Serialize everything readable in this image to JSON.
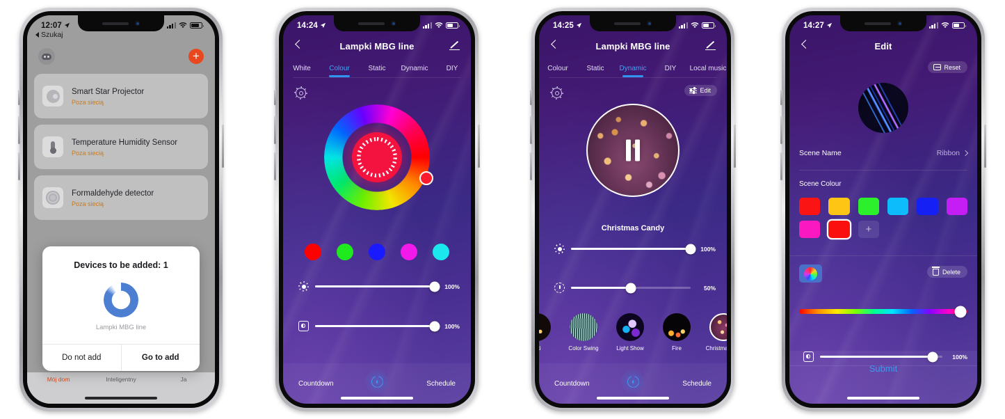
{
  "phones": [
    {
      "id": "device-list",
      "status": {
        "time": "12:07",
        "location_icon": "location-arrow-icon",
        "signal": "signal-bars-icon",
        "wifi": "wifi-icon",
        "battery": "battery-icon"
      },
      "back_link": "Szukaj",
      "toolbar": {
        "scan_icon": "scan-device-icon",
        "add_icon": "plus-icon"
      },
      "devices": [
        {
          "name": "Smart Star Projector",
          "status": "Poza siecią",
          "icon": "projector-icon"
        },
        {
          "name": "Temperature Humidity Sensor",
          "status": "Poza siecią",
          "icon": "thermometer-icon"
        },
        {
          "name": "Formaldehyde detector",
          "status": "Poza siecią",
          "icon": "detector-icon"
        }
      ],
      "dialog": {
        "title": "Devices to be added: 1",
        "device_name": "Lampki MBG line",
        "spinner_icon": "loading-spinner-icon",
        "cancel_label": "Do not add",
        "confirm_label": "Go to add"
      },
      "tabbar": [
        {
          "label": "Mój dom",
          "active": true
        },
        {
          "label": "Inteligentny",
          "active": false
        },
        {
          "label": "Ja",
          "active": false
        }
      ]
    },
    {
      "id": "colour-tab",
      "status": {
        "time": "14:24"
      },
      "nav": {
        "title": "Lampki MBG line",
        "back_icon": "chevron-left-icon",
        "edit_icon": "pencil-icon"
      },
      "tabs": [
        {
          "label": "White",
          "active": false
        },
        {
          "label": "Colour",
          "active": true
        },
        {
          "label": "Static",
          "active": false
        },
        {
          "label": "Dynamic",
          "active": false
        },
        {
          "label": "DIY",
          "active": false
        }
      ],
      "settings_icon": "gear-icon",
      "colour_wheel": {
        "selected_hex": "#f4123f",
        "handle_icon": "colour-wheel-handle"
      },
      "swatches": [
        "#ff0000",
        "#1eea1e",
        "#1a1aff",
        "#f21aea",
        "#1ae8ee"
      ],
      "sliders": [
        {
          "icon": "brightness-icon",
          "value": "100%",
          "percent": 100
        },
        {
          "icon": "colour-temperature-icon",
          "value": "100%",
          "percent": 100
        }
      ],
      "bottombar": {
        "left": "Countdown",
        "power_icon": "power-icon",
        "right": "Schedule"
      }
    },
    {
      "id": "dynamic-tab",
      "status": {
        "time": "14:25"
      },
      "nav": {
        "title": "Lampki MBG line",
        "back_icon": "chevron-left-icon",
        "edit_icon": "pencil-icon"
      },
      "tabs": [
        {
          "label": "Colour",
          "active": false
        },
        {
          "label": "Static",
          "active": false
        },
        {
          "label": "Dynamic",
          "active": true
        },
        {
          "label": "DIY",
          "active": false
        },
        {
          "label": "Local music",
          "active": false
        }
      ],
      "settings_icon": "gear-icon",
      "edit_button": {
        "label": "Edit",
        "icon": "sliders-icon"
      },
      "preview": {
        "playing_icon": "pause-icon",
        "scene_name": "Christmas Candy"
      },
      "sliders": [
        {
          "icon": "brightness-icon",
          "value": "100%",
          "percent": 100
        },
        {
          "icon": "speed-icon",
          "value": "50%",
          "percent": 50
        }
      ],
      "scenes": [
        {
          "label": "etti",
          "selected": false
        },
        {
          "label": "Color Swing",
          "selected": false
        },
        {
          "label": "Light Show",
          "selected": false
        },
        {
          "label": "Fire",
          "selected": false
        },
        {
          "label": "Christmas C...",
          "selected": true
        }
      ],
      "bottombar": {
        "left": "Countdown",
        "power_icon": "power-icon",
        "right": "Schedule"
      }
    },
    {
      "id": "edit-scene",
      "status": {
        "time": "14:27"
      },
      "nav": {
        "title": "Edit",
        "back_icon": "chevron-left-icon"
      },
      "reset_button": {
        "label": "Reset",
        "icon": "reset-icon"
      },
      "hero_icon": "scene-preview-ribbon",
      "scene_name_row": {
        "label": "Scene Name",
        "value": "Ribbon",
        "chevron_icon": "chevron-right-icon"
      },
      "scene_colour_label": "Scene Colour",
      "scene_colours": [
        {
          "hex": "#fb1414",
          "selected": false
        },
        {
          "hex": "#ffc515",
          "selected": false
        },
        {
          "hex": "#2bf02b",
          "selected": false
        },
        {
          "hex": "#0cbcfb",
          "selected": false
        },
        {
          "hex": "#1520f5",
          "selected": false
        },
        {
          "hex": "#c41ef5",
          "selected": false
        },
        {
          "hex": "#fa18c0",
          "selected": false
        },
        {
          "hex": "#fb1010",
          "selected": true
        }
      ],
      "add_colour_icon": "plus-icon",
      "colour_wheel_chip_icon": "colour-wheel-icon",
      "delete_button": {
        "label": "Delete",
        "icon": "trash-icon"
      },
      "hue_slider": {
        "percent": 96
      },
      "brightness_slider": {
        "icon": "colour-temperature-icon",
        "value": "100%",
        "percent": 92
      },
      "submit_label": "Submit"
    }
  ]
}
